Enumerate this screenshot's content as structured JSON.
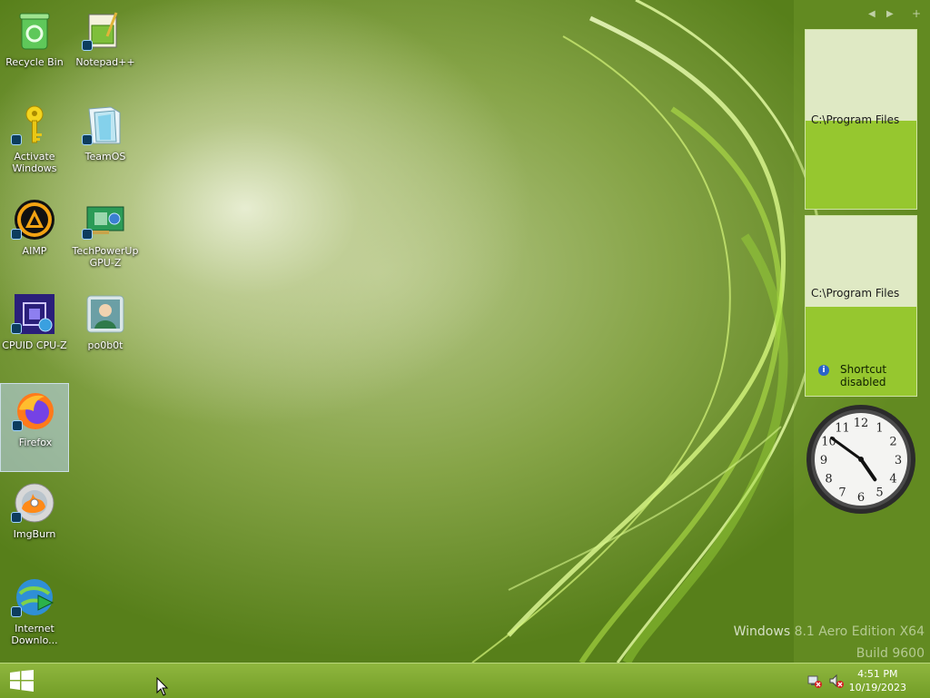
{
  "desktop": {
    "icons": [
      {
        "label": "Recycle Bin"
      },
      {
        "label": "Notepad++"
      },
      {
        "label": "Activate Windows"
      },
      {
        "label": "TeamOS"
      },
      {
        "label": "AIMP"
      },
      {
        "label": "TechPowerUp GPU-Z"
      },
      {
        "label": "CPUID CPU-Z"
      },
      {
        "label": "po0b0t"
      },
      {
        "label": "Firefox"
      },
      {
        "label": "ImgBurn"
      },
      {
        "label": "Internet Downlo..."
      }
    ],
    "watermark": {
      "line1": "Windows 8.1 Aero Edition X64",
      "line2": "Build 9600"
    }
  },
  "sidebar": {
    "controls": {
      "prev": "◀",
      "next": "▶",
      "add": "+"
    },
    "gadget1": {
      "path": "C:\\Program Files"
    },
    "gadget2": {
      "path": "C:\\Program Files",
      "info": "Shortcut disabled",
      "info_icon": "i"
    },
    "clock": {
      "hour": 4,
      "minute": 51
    }
  },
  "taskbar": {
    "time": "4:51 PM",
    "date": "10/19/2023"
  }
}
